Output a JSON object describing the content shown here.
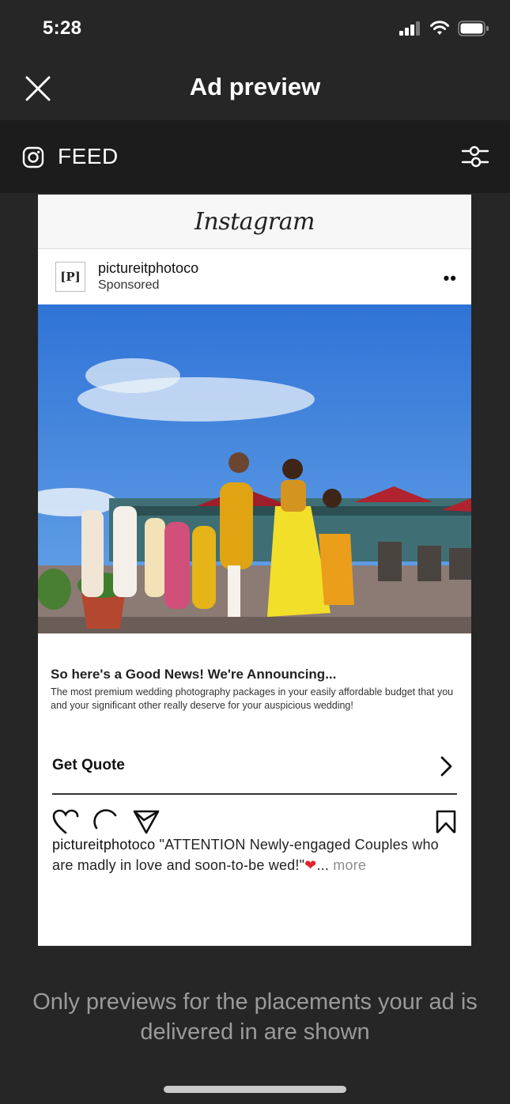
{
  "status_bar": {
    "time": "5:28"
  },
  "header": {
    "title": "Ad preview"
  },
  "placement": {
    "label": "FEED"
  },
  "ad": {
    "platform_logo": "Instagram",
    "account": "pictureitphotoco",
    "sponsored": "Sponsored",
    "avatar_text": "[P]",
    "headline": "So here's a Good News! We're Announcing...",
    "body": "The most premium wedding photography packages in your easily affordable budget that you and your significant other really deserve for your auspicious wedding!",
    "cta": "Get Quote",
    "caption_user": "pictureitphotoco",
    "caption_text": " \"ATTENTION Newly-engaged Couples who are madly in love and soon-to-be wed!\"",
    "caption_ellipsis": "... ",
    "caption_more": "more"
  },
  "footer": {
    "note": "Only previews for the placements your ad is delivered in are shown"
  },
  "icons": {
    "close": "close-icon",
    "instagram": "instagram-icon",
    "filter": "filter-icon",
    "like": "heart-icon",
    "comment": "comment-icon",
    "share": "share-icon",
    "save": "bookmark-icon",
    "chevron": "chevron-right-icon"
  }
}
